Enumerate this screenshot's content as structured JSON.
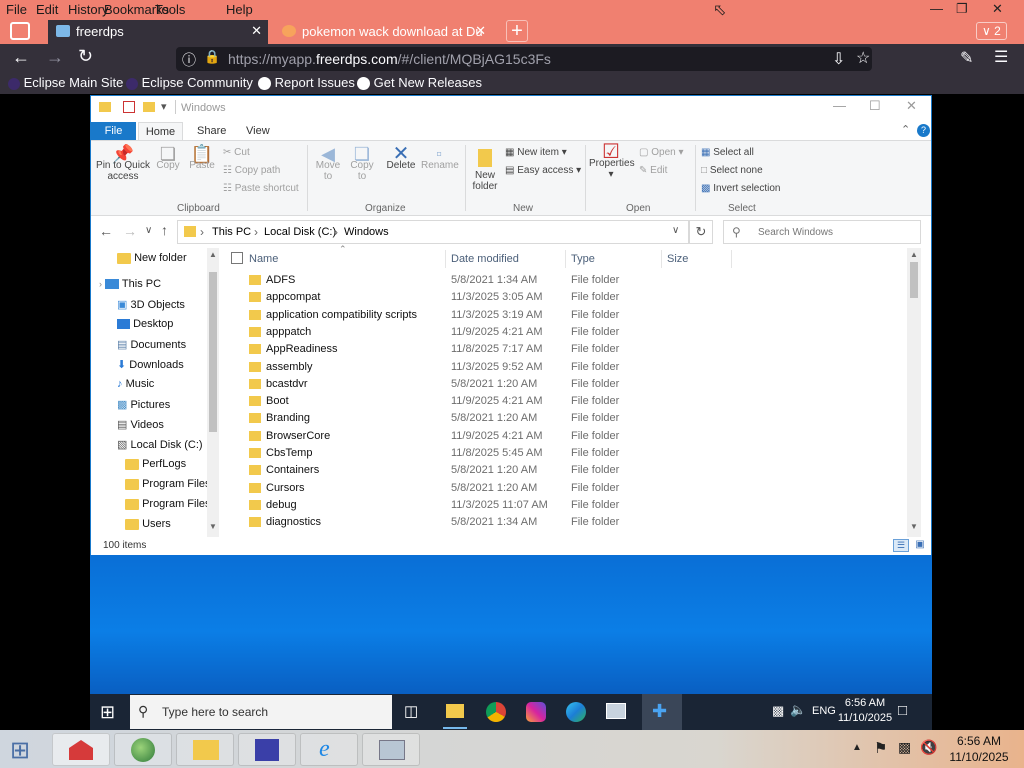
{
  "browser": {
    "menu": [
      "File",
      "Edit",
      "History",
      "Bookmarks",
      "Tools",
      "Help"
    ],
    "tabs": [
      {
        "title": "freerdps",
        "active": true
      },
      {
        "title": "pokemon wack download at Du",
        "active": false
      }
    ],
    "tab_count_badge": "2",
    "url_prefix": "https://myapp.",
    "url_host": "freerdps.com",
    "url_path": "/#/client/MQBjAG15c3Fs",
    "bookmarks": [
      "Eclipse Main Site",
      "Eclipse Community",
      "Report Issues",
      "Get New Releases"
    ]
  },
  "explorer": {
    "title": "Windows",
    "ribbon_tabs": [
      "File",
      "Home",
      "Share",
      "View"
    ],
    "clipboard": {
      "pin": "Pin to Quick access",
      "copy": "Copy",
      "paste": "Paste",
      "cut": "Cut",
      "copy_path": "Copy path",
      "paste_shortcut": "Paste shortcut",
      "group": "Clipboard"
    },
    "organize": {
      "move_to": "Move to",
      "copy_to": "Copy to",
      "delete": "Delete",
      "rename": "Rename",
      "group": "Organize"
    },
    "new": {
      "new_folder": "New folder",
      "new_item": "New item",
      "easy_access": "Easy access",
      "group": "New"
    },
    "open": {
      "properties": "Properties",
      "open": "Open",
      "edit": "Edit",
      "group": "Open"
    },
    "select": {
      "select_all": "Select all",
      "select_none": "Select none",
      "invert": "Invert selection",
      "group": "Select"
    },
    "breadcrumb": [
      "This PC",
      "Local Disk (C:)",
      "Windows"
    ],
    "search_placeholder": "Search Windows",
    "columns": {
      "name": "Name",
      "date": "Date modified",
      "type": "Type",
      "size": "Size"
    },
    "nav": [
      "New folder",
      "This PC",
      "3D Objects",
      "Desktop",
      "Documents",
      "Downloads",
      "Music",
      "Pictures",
      "Videos",
      "Local Disk (C:)",
      "PerfLogs",
      "Program Files",
      "Program Files (",
      "Users"
    ],
    "files": [
      {
        "name": "ADFS",
        "date": "5/8/2021 1:34 AM",
        "type": "File folder"
      },
      {
        "name": "appcompat",
        "date": "11/3/2025 3:05 AM",
        "type": "File folder"
      },
      {
        "name": "application compatibility scripts",
        "date": "11/3/2025 3:19 AM",
        "type": "File folder"
      },
      {
        "name": "apppatch",
        "date": "11/9/2025 4:21 AM",
        "type": "File folder"
      },
      {
        "name": "AppReadiness",
        "date": "11/8/2025 7:17 AM",
        "type": "File folder"
      },
      {
        "name": "assembly",
        "date": "11/3/2025 9:52 AM",
        "type": "File folder"
      },
      {
        "name": "bcastdvr",
        "date": "5/8/2021 1:20 AM",
        "type": "File folder"
      },
      {
        "name": "Boot",
        "date": "11/9/2025 4:21 AM",
        "type": "File folder"
      },
      {
        "name": "Branding",
        "date": "5/8/2021 1:20 AM",
        "type": "File folder"
      },
      {
        "name": "BrowserCore",
        "date": "11/9/2025 4:21 AM",
        "type": "File folder"
      },
      {
        "name": "CbsTemp",
        "date": "11/8/2025 5:45 AM",
        "type": "File folder"
      },
      {
        "name": "Containers",
        "date": "5/8/2021 1:20 AM",
        "type": "File folder"
      },
      {
        "name": "Cursors",
        "date": "5/8/2021 1:20 AM",
        "type": "File folder"
      },
      {
        "name": "debug",
        "date": "11/3/2025 11:07 AM",
        "type": "File folder"
      },
      {
        "name": "diagnostics",
        "date": "5/8/2021 1:34 AM",
        "type": "File folder"
      }
    ],
    "status": "100 items"
  },
  "remote_taskbar": {
    "search_placeholder": "Type here to search",
    "lang": "ENG",
    "time": "6:56 AM",
    "date": "11/10/2025"
  },
  "host_taskbar": {
    "time": "6:56 AM",
    "date": "11/10/2025"
  }
}
